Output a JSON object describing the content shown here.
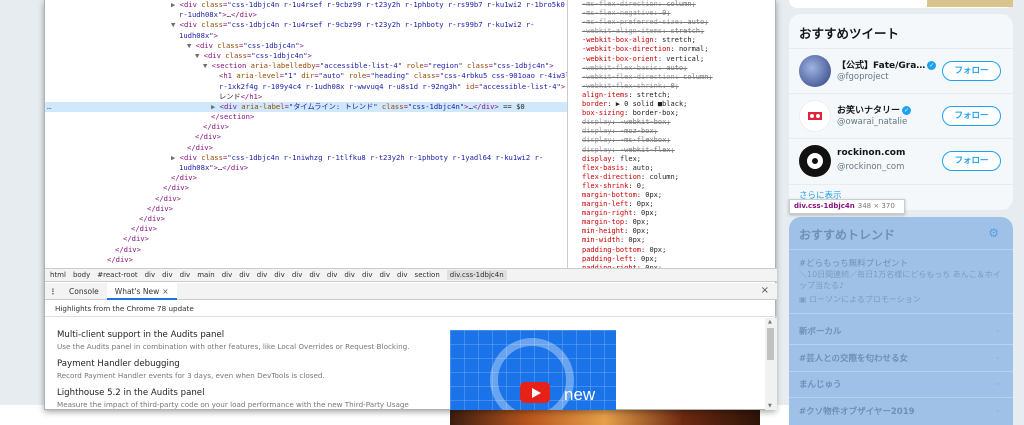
{
  "devtools": {
    "dom_lines": [
      {
        "indent": 30,
        "html": "<span class='tri'>▶</span> <span class='t'>&lt;div</span> <span class='a'>class</span>=<span class='v'>\"css-1dbjc4n r-1u4rsef r-9cbz99 r-t23y2h r-1phboty r-rs99b7 r-ku1wi2 r-1bro5k0</span>"
      },
      {
        "indent": 38,
        "html": "<span class='v'>r-1udh08x\"</span><span class='t'>&gt;</span><span class='tx'>…</span><span class='t'>&lt;/div&gt;</span>"
      },
      {
        "indent": 30,
        "html": "<span class='tri'>▼</span> <span class='t'>&lt;div</span> <span class='a'>class</span>=<span class='v'>\"css-1dbjc4n r-1u4rsef r-9cbz99 r-t23y2h r-1phboty r-rs99b7 r-ku1wi2 r-</span>"
      },
      {
        "indent": 38,
        "html": "<span class='v'>1udh08x\"</span><span class='t'>&gt;</span>"
      },
      {
        "indent": 46,
        "html": "<span class='tri'>▼</span> <span class='t'>&lt;div</span> <span class='a'>class</span>=<span class='v'>\"css-1dbjc4n\"</span><span class='t'>&gt;</span>"
      },
      {
        "indent": 54,
        "html": "<span class='tri'>▼</span> <span class='t'>&lt;div</span> <span class='a'>class</span>=<span class='v'>\"css-1dbjc4n\"</span><span class='t'>&gt;</span>"
      },
      {
        "indent": 62,
        "html": "<span class='tri'>▼</span> <span class='t'>&lt;section</span> <span class='a'>aria-labelledby</span>=<span class='v'>\"accessible-list-4\"</span> <span class='a'>role</span>=<span class='v'>\"region\"</span> <span class='a'>class</span>=<span class='v'>\"css-1dbjc4n\"</span><span class='t'>&gt;</span>"
      },
      {
        "indent": 78,
        "html": "<span class='t'>&lt;h1</span> <span class='a'>aria-level</span>=<span class='v'>\"1\"</span> <span class='a'>dir</span>=<span class='v'>\"auto\"</span> <span class='a'>role</span>=<span class='v'>\"heading\"</span> <span class='a'>class</span>=<span class='v'>\"css-4rbku5 css-901oao r-4iw3lz</span>"
      },
      {
        "indent": 78,
        "html": "<span class='v'>r-1xk2f4g r-109y4c4 r-1udh08x r-wwvuq4 r-u8s1d r-92ng3h\"</span> <span class='a'>id</span>=<span class='v'>\"accessible-list-4\"</span><span class='t'>&gt;</span><span class='tx'>ト</span>"
      },
      {
        "indent": 78,
        "html": "<span class='tx'>レンド</span><span class='t'>&lt;/h1&gt;</span>"
      },
      {
        "indent": 70,
        "sel": true,
        "html": "<span class='tri'>▶</span> <span class='t'>&lt;div</span> <span class='a'>aria-label</span>=<span class='v'>\"タイムライン: トレンド\"</span> <span class='a'>class</span>=<span class='v'>\"css-1dbjc4n\"</span><span class='t'>&gt;</span><span class='tx'>…</span><span class='t'>&lt;/div&gt;</span> <span class='tx'>== $0</span>"
      },
      {
        "indent": 70,
        "html": "<span class='t'>&lt;/section&gt;</span>"
      },
      {
        "indent": 62,
        "html": "<span class='t'>&lt;/div&gt;</span>"
      },
      {
        "indent": 54,
        "html": "<span class='t'>&lt;/div&gt;</span>"
      },
      {
        "indent": 46,
        "html": "<span class='t'>&lt;/div&gt;</span>"
      },
      {
        "indent": 30,
        "html": "<span class='tri'>▶</span> <span class='t'>&lt;div</span> <span class='a'>class</span>=<span class='v'>\"css-1dbjc4n r-1niwhzg r-1tlfku8 r-t23y2h r-1phboty r-1yadl64 r-ku1wi2 r-</span>"
      },
      {
        "indent": 38,
        "html": "<span class='v'>1udh08x\"</span><span class='t'>&gt;</span><span class='tx'>…</span><span class='t'>&lt;/div&gt;</span>"
      },
      {
        "indent": 30,
        "html": "<span class='t'>&lt;/div&gt;</span>"
      },
      {
        "indent": 22,
        "html": "<span class='t'>&lt;/div&gt;</span>"
      },
      {
        "indent": 14,
        "html": "<span class='t'>&lt;/div&gt;</span>"
      },
      {
        "indent": 6,
        "html": "<span class='t'>&lt;/div&gt;</span>"
      },
      {
        "indent": -2,
        "html": "<span class='t'>&lt;/div&gt;</span>"
      },
      {
        "indent": -10,
        "html": "<span class='t'>&lt;/div&gt;</span>"
      },
      {
        "indent": -18,
        "html": "<span class='t'>&lt;/div&gt;</span>"
      },
      {
        "indent": -26,
        "html": "<span class='t'>&lt;/div&gt;</span>"
      },
      {
        "indent": -34,
        "html": "<span class='t'>&lt;/div&gt;</span>"
      }
    ],
    "style_lines": [
      {
        "s": true,
        "text": "-ms-flex-direction: column;"
      },
      {
        "s": true,
        "text": "-ms-flex-negative: 0;"
      },
      {
        "s": true,
        "text": "-ms-flex-preferred-size: auto;"
      },
      {
        "s": true,
        "text": "-webkit-align-items: stretch;"
      },
      {
        "s": false,
        "text": "-webkit-box-align: stretch;"
      },
      {
        "s": false,
        "text": "-webkit-box-direction: normal;"
      },
      {
        "s": false,
        "text": "-webkit-box-orient: vertical;"
      },
      {
        "s": true,
        "text": "-webkit-flex-basis: auto;"
      },
      {
        "s": true,
        "text": "-webkit-flex-direction: column;"
      },
      {
        "s": true,
        "text": "-webkit-flex-shrink: 0;"
      },
      {
        "s": false,
        "text": "align-items: stretch;"
      },
      {
        "s": false,
        "text": "border: ▶ 0 solid ■black;"
      },
      {
        "s": false,
        "text": "box-sizing: border-box;"
      },
      {
        "s": true,
        "text": "display: -webkit-box;"
      },
      {
        "s": true,
        "text": "display: -moz-box;"
      },
      {
        "s": true,
        "text": "display: -ms-flexbox;"
      },
      {
        "s": true,
        "text": "display: -webkit-flex;"
      },
      {
        "s": false,
        "text": "display: flex;"
      },
      {
        "s": false,
        "text": "flex-basis: auto;"
      },
      {
        "s": false,
        "text": "flex-direction: column;"
      },
      {
        "s": false,
        "text": "flex-shrink: 0;"
      },
      {
        "s": false,
        "text": "margin-bottom: 0px;"
      },
      {
        "s": false,
        "text": "margin-left: 0px;"
      },
      {
        "s": false,
        "text": "margin-right: 0px;"
      },
      {
        "s": false,
        "text": "margin-top: 0px;"
      },
      {
        "s": false,
        "text": "min-height: 0px;"
      },
      {
        "s": false,
        "text": "min-width: 0px;"
      },
      {
        "s": false,
        "text": "padding-bottom: 0px;"
      },
      {
        "s": false,
        "text": "padding-left: 0px;"
      },
      {
        "s": false,
        "text": "padding-right: 0px;"
      },
      {
        "s": false,
        "text": "padding-top: 0px;"
      },
      {
        "s": false,
        "text": "position: relative;"
      }
    ],
    "breadcrumbs": [
      "html",
      "body",
      "#react-root",
      "div",
      "div",
      "div",
      "main",
      "div",
      "div",
      "div",
      "div",
      "div",
      "div",
      "div",
      "div",
      "div",
      "div",
      "div",
      "section",
      "div.css-1dbjc4n"
    ],
    "drawer": {
      "console_tab": "Console",
      "whatsnew_tab": "What's New",
      "tab_close": "×",
      "drawer_close": "×",
      "header": "Highlights from the Chrome 78 update",
      "items": [
        {
          "title": "Multi-client support in the Audits panel",
          "desc": "Use the Audits panel in combination with other features, like Local Overrides or Request Blocking."
        },
        {
          "title": "Payment Handler debugging",
          "desc": "Record Payment Handler events for 3 days, even when DevTools is closed."
        },
        {
          "title": "Lighthouse 5.2 in the Audits panel",
          "desc": "Measure the impact of third-party code on your load performance with the new Third-Party Usage"
        }
      ],
      "promo_word": "new"
    }
  },
  "tooltip": {
    "cls": "div.css-1dbjc4n",
    "dims": "348 × 370"
  },
  "sidebar": {
    "recommend_title": "おすすめツイート",
    "users": [
      {
        "name": "【公式】Fate/Gra…",
        "handle": "@fgoproject",
        "follow": "フォロー",
        "avatar_color": "#3a4f8a"
      },
      {
        "name": "お笑いナタリー",
        "handle": "@owarai_natalie",
        "follow": "フォロー",
        "avatar_color": "#e0243a"
      },
      {
        "name": "rockinon.com",
        "handle": "@rockinon_com",
        "follow": "フォロー",
        "avatar_color": "#1b1b1b"
      }
    ],
    "show_more": "さらに表示",
    "trends_title": "おすすめトレンド",
    "trends": [
      {
        "tag": "#どらもっち無料プレゼント",
        "desc": "＼10日間連続／毎日1万名様にどらもっち あんこ＆ホイップ当たる♪",
        "promoted": "ローソンによるプロモーション"
      },
      {
        "tag": "新ボーカル"
      },
      {
        "tag": "#芸人との交際を匂わせる女"
      },
      {
        "tag": "まんじゅう"
      },
      {
        "tag": "#クソ物件オブザイヤー2019"
      }
    ]
  }
}
